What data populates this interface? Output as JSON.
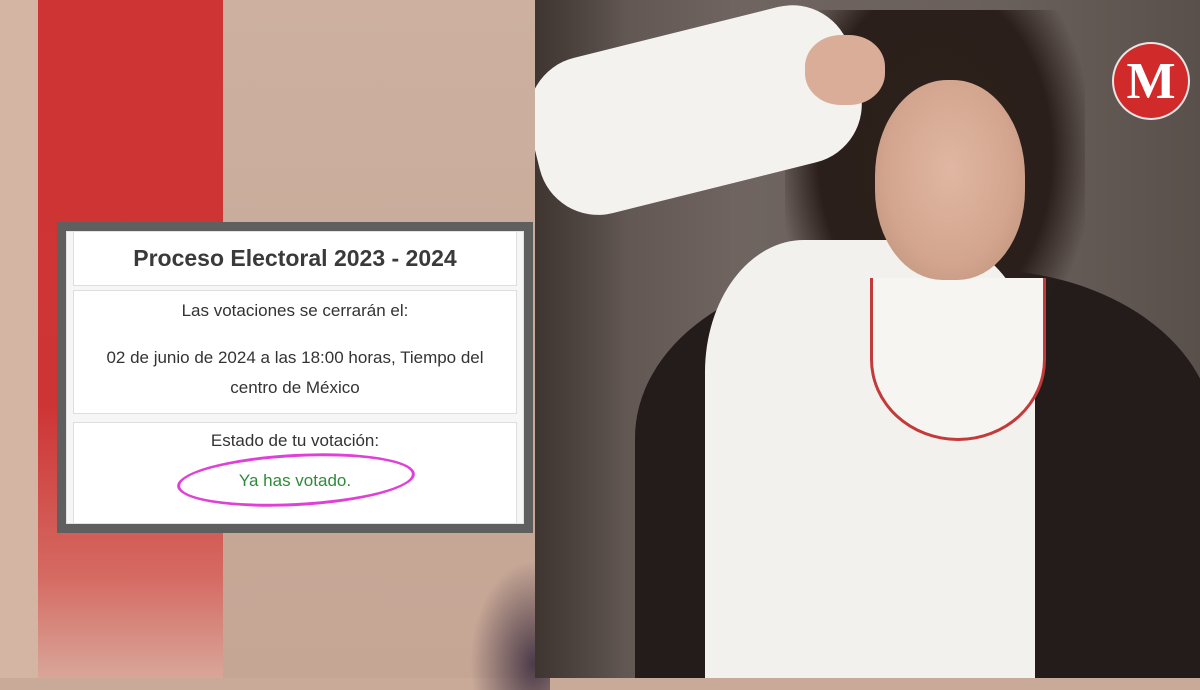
{
  "card": {
    "title": "Proceso Electoral 2023 - 2024",
    "close_label": "Las votaciones se cerrarán el:",
    "close_date": "02 de junio de 2024 a las 18:00 horas, Tiempo del centro de México",
    "status_label": "Estado de tu votación:",
    "status_value": "Ya has votado."
  },
  "logo": {
    "letter": "M",
    "color": "#d02a2a"
  },
  "colors": {
    "status_green": "#2e8b3a",
    "highlight_circle": "#e040d8",
    "accent_red": "#cf3434"
  }
}
